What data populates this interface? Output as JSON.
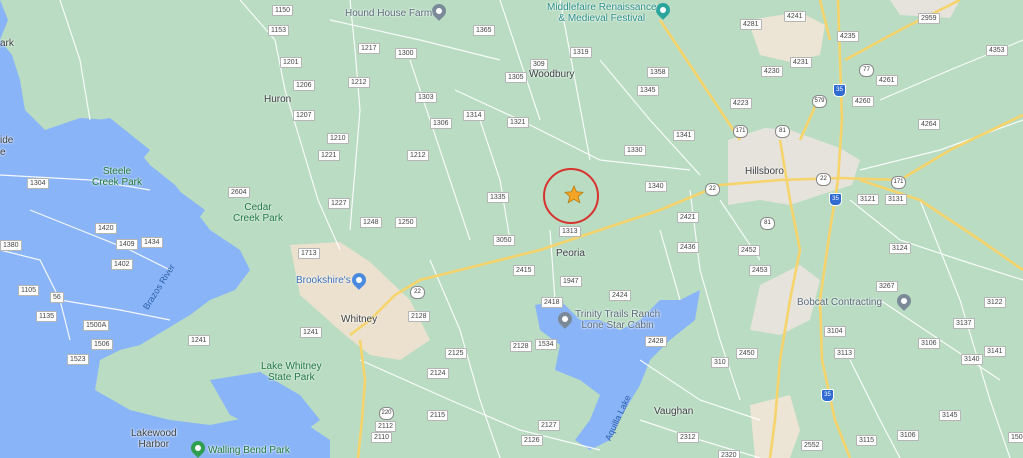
{
  "map": {
    "colors": {
      "land": "#b9dcc2",
      "water": "#8ab4f8",
      "urban": "#e9e4db",
      "highway": "#f6d46b",
      "marker_ring": "#d8322e",
      "marker_star": "#f4a424"
    },
    "towns": {
      "hillsboro": "Hillsboro",
      "whitney": "Whitney",
      "peoria": "Peoria",
      "woodbury": "Woodbury",
      "huron": "Huron",
      "vaughan": "Vaughan",
      "lakewood_harbor": "Lakewood\nHarbor",
      "edge_left_1": "ide",
      "edge_left_2": "e",
      "edge_left_3": "ark"
    },
    "parks": {
      "steele_creek": "Steele\nCreek Park",
      "cedar_creek": "Cedar\nCreek Park",
      "lake_whitney_sp": "Lake Whitney\nState Park"
    },
    "water": {
      "brazos_river": "Brazos River",
      "aquilla_lake": "Aquilla Lake"
    },
    "pois": {
      "hound_house_farm": "Hound House Farm",
      "middlefaire": "Middlefaire Renaissance\n& Medieval Festival",
      "brookshires": "Brookshire's",
      "trinity_trails": "Trinity Trails Ranch\nLone Star Cabin",
      "bobcat": "Bobcat Contracting",
      "walling_bend": "Walling Bend Park"
    },
    "road_numbers": [
      "1150",
      "1153",
      "1201",
      "1206",
      "1207",
      "1210",
      "1217",
      "1212",
      "1300",
      "1303",
      "1306",
      "1314",
      "1321",
      "1365",
      "1305",
      "309",
      "1319",
      "1358",
      "1345",
      "1341",
      "1330",
      "1340",
      "1335",
      "3050",
      "1313",
      "1221",
      "1212",
      "1227",
      "1248",
      "1250",
      "1713",
      "2604",
      "1420",
      "1409",
      "1434",
      "1402",
      "1380",
      "1304",
      "1105",
      "56",
      "1135",
      "1500A",
      "1506",
      "1241",
      "1523",
      "1241",
      "2128",
      "2125",
      "2124",
      "2115",
      "2112",
      "2110",
      "22",
      "220",
      "2415",
      "1947",
      "2418",
      "1534",
      "2128",
      "2424",
      "2127",
      "2126",
      "2428",
      "2421",
      "2436",
      "2452",
      "2453",
      "310",
      "2450",
      "2312",
      "2320",
      "4281",
      "4241",
      "4235",
      "4231",
      "4230",
      "4223",
      "4261",
      "4260",
      "4264",
      "4353",
      "2959",
      "3121",
      "3131",
      "3124",
      "3267",
      "3104",
      "3113",
      "3106",
      "3137",
      "3122",
      "3140",
      "3141",
      "3145",
      "3106",
      "3115",
      "2552",
      "1500"
    ],
    "interstates": [
      "35",
      "35",
      "35"
    ],
    "us_routes": [
      "81",
      "81",
      "77",
      "22",
      "22",
      "171",
      "171",
      "579"
    ]
  }
}
